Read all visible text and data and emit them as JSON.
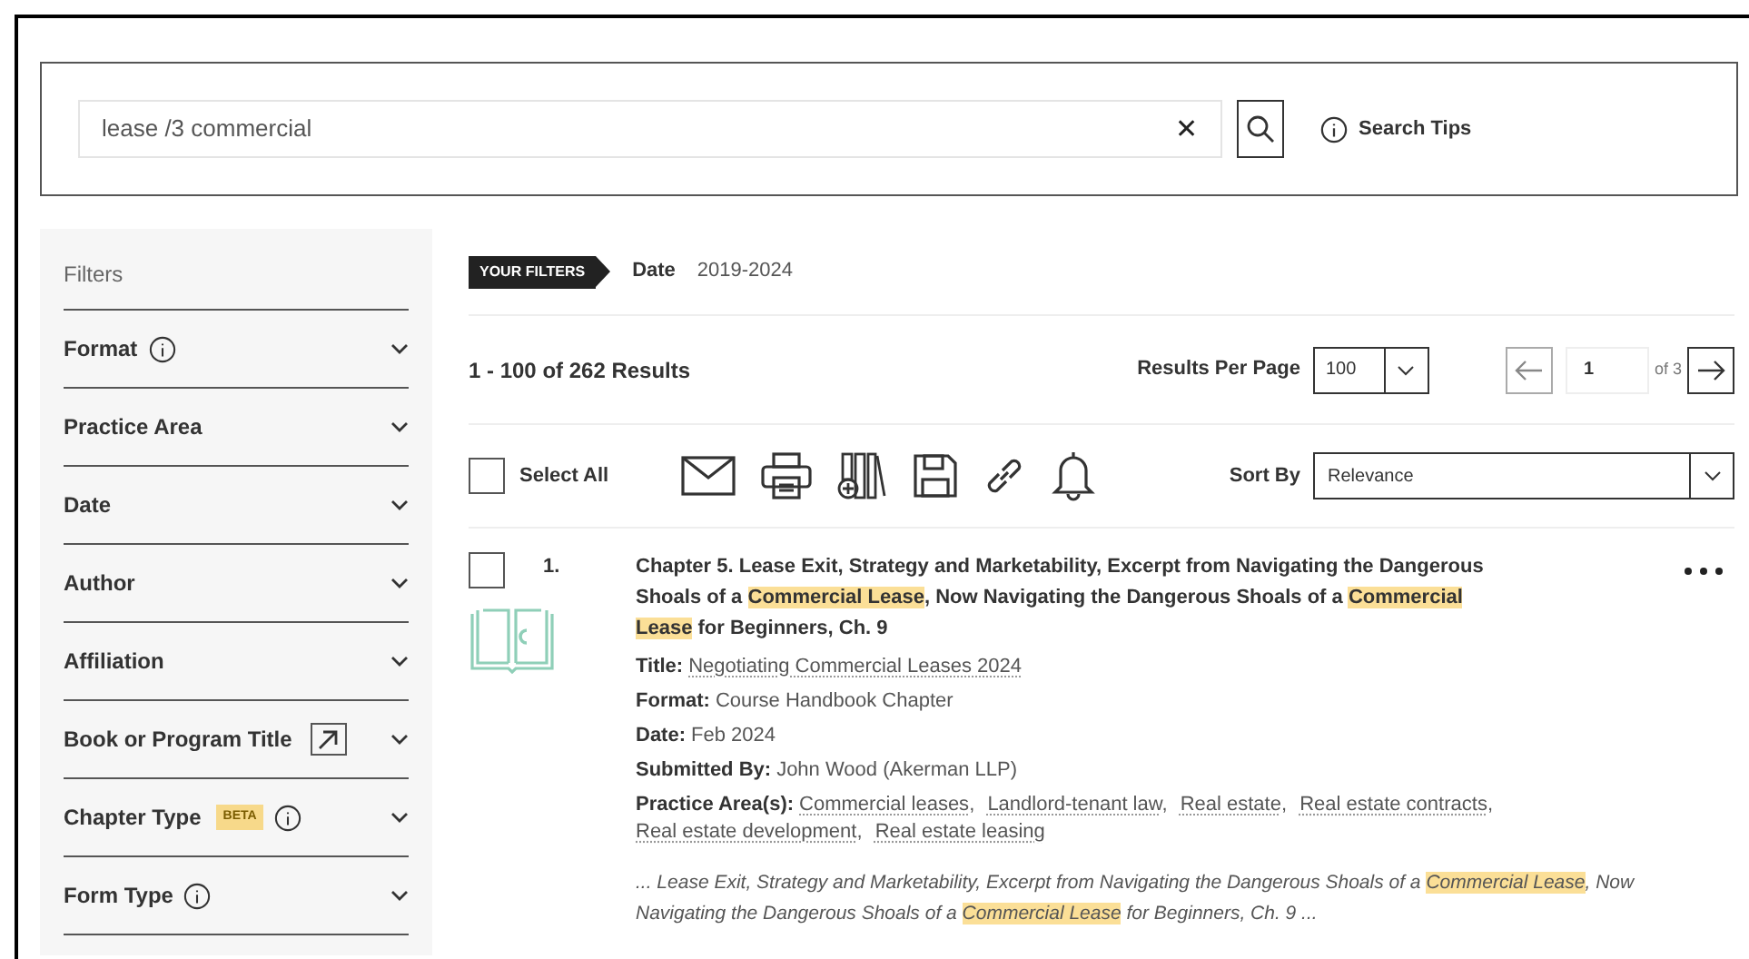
{
  "search": {
    "value": "lease /3 commercial",
    "clear_glyph": "✕",
    "tips_label": "Search Tips"
  },
  "filters": {
    "heading": "Filters",
    "items": [
      {
        "label": "Format",
        "info": true
      },
      {
        "label": "Practice Area"
      },
      {
        "label": "Date"
      },
      {
        "label": "Author"
      },
      {
        "label": "Affiliation"
      },
      {
        "label": "Book or Program Title",
        "external_link": true
      },
      {
        "label": "Chapter Type",
        "badge": "BETA",
        "info": true
      },
      {
        "label": "Form Type",
        "info": true
      }
    ]
  },
  "active_filters": {
    "tag": "YOUR FILTERS",
    "items": [
      {
        "name": "Date",
        "value": "2019-2024"
      }
    ]
  },
  "results_bar": {
    "count": "1 - 100 of 262 Results",
    "per_page_label": "Results Per Page",
    "per_page": "100",
    "page": "1",
    "page_total": "of 3"
  },
  "toolbar": {
    "select_all": {
      "label": "Select All",
      "checked": false
    },
    "sort_label": "Sort By",
    "sort_value": "Relevance"
  },
  "results": [
    {
      "number": "1.",
      "checked": false,
      "title": [
        {
          "text": "Chapter 5. Lease Exit, Strategy and Marketability, Excerpt from Navigating the Dangerous Shoals of a ",
          "highlighted": false
        },
        {
          "text": "Commercial Lease",
          "highlighted": true
        },
        {
          "text": ", Now Navigating the Dangerous Shoals of a ",
          "highlighted": false
        },
        {
          "text": "Commercial Lease",
          "highlighted": true
        },
        {
          "text": " for Beginners, Ch. 9",
          "highlighted": false
        }
      ],
      "fields": [
        {
          "label": "Title:",
          "value": "Negotiating Commercial Leases 2024",
          "kind": "link"
        },
        {
          "label": "Format:",
          "value": "Course Handbook Chapter",
          "kind": "text"
        },
        {
          "label": "Date:",
          "value": "Feb 2024",
          "kind": "text"
        },
        {
          "label": "Submitted By:",
          "value": "John Wood (Akerman LLP)",
          "kind": "text"
        }
      ],
      "practice_areas": {
        "label": "Practice Area(s):",
        "separator": ",",
        "links": [
          "Commercial leases",
          "Landlord-tenant law",
          "Real estate",
          "Real estate contracts",
          "Real estate development",
          "Real estate leasing"
        ]
      },
      "snippet": [
        {
          "text": "... Lease Exit, Strategy and Marketability, Excerpt from Navigating the Dangerous Shoals of a ",
          "highlighted": false
        },
        {
          "text": "Commercial Lease",
          "highlighted": true
        },
        {
          "text": ", Now Navigating the Dangerous Shoals of a ",
          "highlighted": false
        },
        {
          "text": "Commercial Lease",
          "highlighted": true
        },
        {
          "text": " for Beginners, Ch. 9 ...",
          "highlighted": false
        }
      ]
    }
  ]
}
